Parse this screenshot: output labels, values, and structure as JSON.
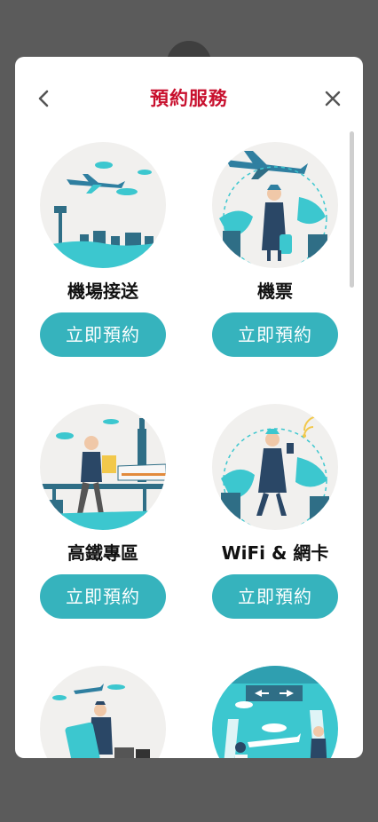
{
  "header": {
    "title": "預約服務"
  },
  "services": [
    {
      "name": "機場接送",
      "button": "立即預約"
    },
    {
      "name": "機票",
      "button": "立即預約"
    },
    {
      "name": "高鐵專區",
      "button": "立即預約"
    },
    {
      "name": "WiFi & 網卡",
      "button": "立即預約"
    }
  ],
  "colors": {
    "title": "#c8102e",
    "button": "#36b3bd",
    "teal": "#3cc7cf",
    "overlay": "#5b5b5b"
  },
  "icons": {
    "back": "chevron-left-icon",
    "close": "close-icon"
  }
}
